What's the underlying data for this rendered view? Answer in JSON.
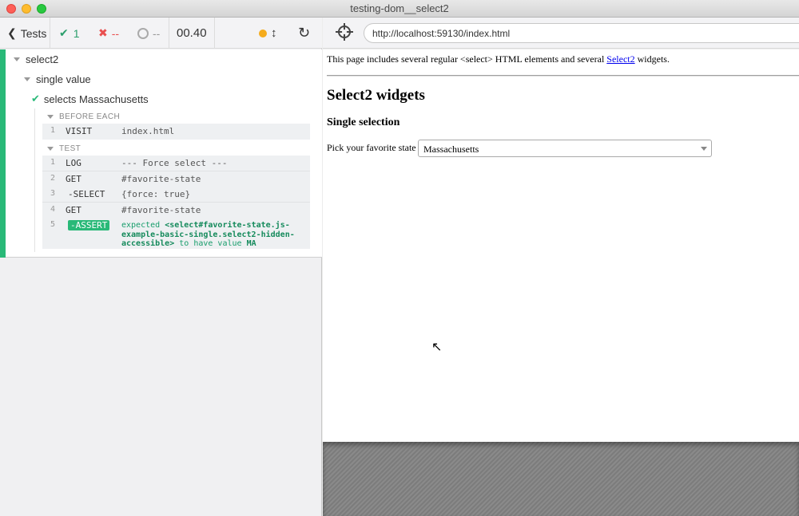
{
  "window": {
    "title": "testing-dom__select2"
  },
  "reporter": {
    "tests_label": "Tests",
    "passed": "1",
    "failed": "--",
    "pending": "--",
    "duration": "00.40",
    "suites": [
      {
        "title": "select2"
      },
      {
        "title": "single value"
      }
    ],
    "test": {
      "title": "selects Massachusetts",
      "before_each_label": "BEFORE EACH",
      "test_label": "TEST",
      "before_each_commands": [
        {
          "num": "1",
          "name": "VISIT",
          "message": "index.html"
        }
      ],
      "commands": [
        {
          "num": "1",
          "name": "LOG",
          "message": "--- Force select ---"
        },
        {
          "num": "2",
          "name": "GET",
          "message": "#favorite-state"
        },
        {
          "num": "3",
          "name": "-SELECT",
          "message": "{force: true}"
        },
        {
          "num": "4",
          "name": "GET",
          "message": "#favorite-state"
        },
        {
          "num": "5",
          "name": "-ASSERT",
          "assert_prefix": "expected",
          "assert_subject": "<select#favorite-state.js-example-basic-single.select2-hidden-accessible>",
          "assert_mid": "to have value",
          "assert_value": "MA"
        }
      ]
    }
  },
  "app": {
    "url": "http://localhost:59130/index.html",
    "page": {
      "intro_text": "This page includes several regular <select> HTML elements and several ",
      "intro_link": "Select2",
      "intro_suffix": " widgets.",
      "heading": "Select2 widgets",
      "subheading": "Single selection",
      "pick_label": "Pick your favorite state",
      "selected_state": "Massachusetts"
    }
  },
  "colors": {
    "pass": "#29b978",
    "fail": "#e94f4f",
    "running": "#f5ac1d",
    "link": "#0000ee"
  },
  "icons": [
    "chevron-left-icon",
    "check-icon",
    "x-icon",
    "circle-icon",
    "running-dot-icon",
    "scroll-icon",
    "reload-icon",
    "crosshair-icon",
    "chevron-down-icon",
    "cursor-icon"
  ]
}
